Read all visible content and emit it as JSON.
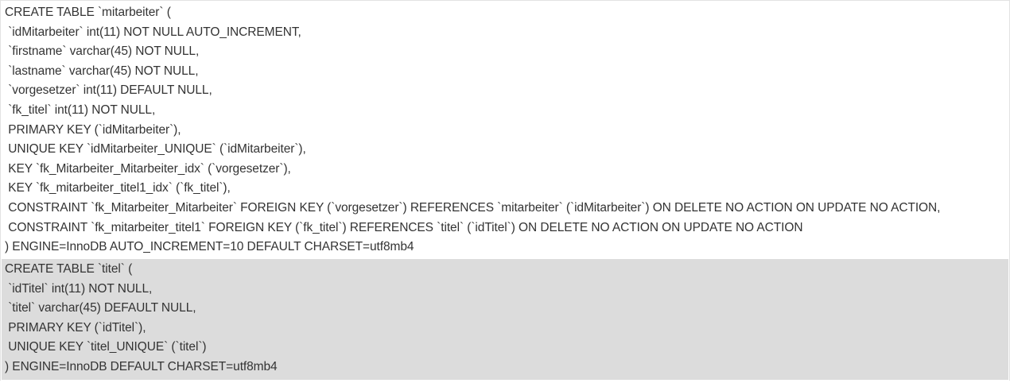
{
  "statements": [
    {
      "table": "mitarbeiter",
      "lines": [
        "CREATE TABLE `mitarbeiter` (",
        " `idMitarbeiter` int(11) NOT NULL AUTO_INCREMENT,",
        " `firstname` varchar(45) NOT NULL,",
        " `lastname` varchar(45) NOT NULL,",
        " `vorgesetzer` int(11) DEFAULT NULL,",
        " `fk_titel` int(11) NOT NULL,",
        " PRIMARY KEY (`idMitarbeiter`),",
        " UNIQUE KEY `idMitarbeiter_UNIQUE` (`idMitarbeiter`),",
        " KEY `fk_Mitarbeiter_Mitarbeiter_idx` (`vorgesetzer`),",
        " KEY `fk_mitarbeiter_titel1_idx` (`fk_titel`),",
        " CONSTRAINT `fk_Mitarbeiter_Mitarbeiter` FOREIGN KEY (`vorgesetzer`) REFERENCES `mitarbeiter` (`idMitarbeiter`) ON DELETE NO ACTION ON UPDATE NO ACTION,",
        " CONSTRAINT `fk_mitarbeiter_titel1` FOREIGN KEY (`fk_titel`) REFERENCES `titel` (`idTitel`) ON DELETE NO ACTION ON UPDATE NO ACTION",
        ") ENGINE=InnoDB AUTO_INCREMENT=10 DEFAULT CHARSET=utf8mb4"
      ]
    },
    {
      "table": "titel",
      "lines": [
        "CREATE TABLE `titel` (",
        " `idTitel` int(11) NOT NULL,",
        " `titel` varchar(45) DEFAULT NULL,",
        " PRIMARY KEY (`idTitel`),",
        " UNIQUE KEY `titel_UNIQUE` (`titel`)",
        ") ENGINE=InnoDB DEFAULT CHARSET=utf8mb4"
      ]
    }
  ],
  "colors": {
    "text": "#333333",
    "row_alt_background": "#dcdcdc",
    "background": "#ffffff",
    "border": "#e2e2e2"
  }
}
